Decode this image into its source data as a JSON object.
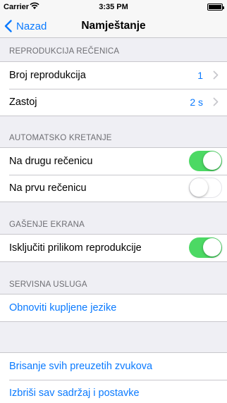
{
  "status_bar": {
    "carrier": "Carrier",
    "wifi_icon": "wifi-icon",
    "time": "3:35 PM",
    "battery_icon": "battery-icon"
  },
  "nav": {
    "back_label": "Nazad",
    "title": "Namještanje"
  },
  "sections": {
    "playback": {
      "header": "REPRODUKCIJA REČENICA",
      "repeat_count": {
        "label": "Broj reprodukcija",
        "value": "1"
      },
      "delay": {
        "label": "Zastoj",
        "value": "2 s"
      }
    },
    "auto_move": {
      "header": "AUTOMATSKO KRETANJE",
      "next_sentence": {
        "label": "Na drugu rečenicu",
        "on": true
      },
      "first_sentence": {
        "label": "Na prvu rečenicu",
        "on": false
      }
    },
    "screen_off": {
      "header": "GAŠENJE EKRANA",
      "disable_during_playback": {
        "label": "Isključiti prilikom reprodukcije",
        "on": true
      }
    },
    "service": {
      "header": "SERVISNA USLUGA",
      "restore_purchases": "Obnoviti kupljene jezike"
    },
    "data": {
      "delete_sounds": "Brisanje svih preuzetih zvukova",
      "erase_all": "Izbriši sav sadržaj i postavke"
    }
  },
  "colors": {
    "accent": "#0a7aff",
    "switch_on": "#4cd964",
    "background": "#efeff4"
  }
}
